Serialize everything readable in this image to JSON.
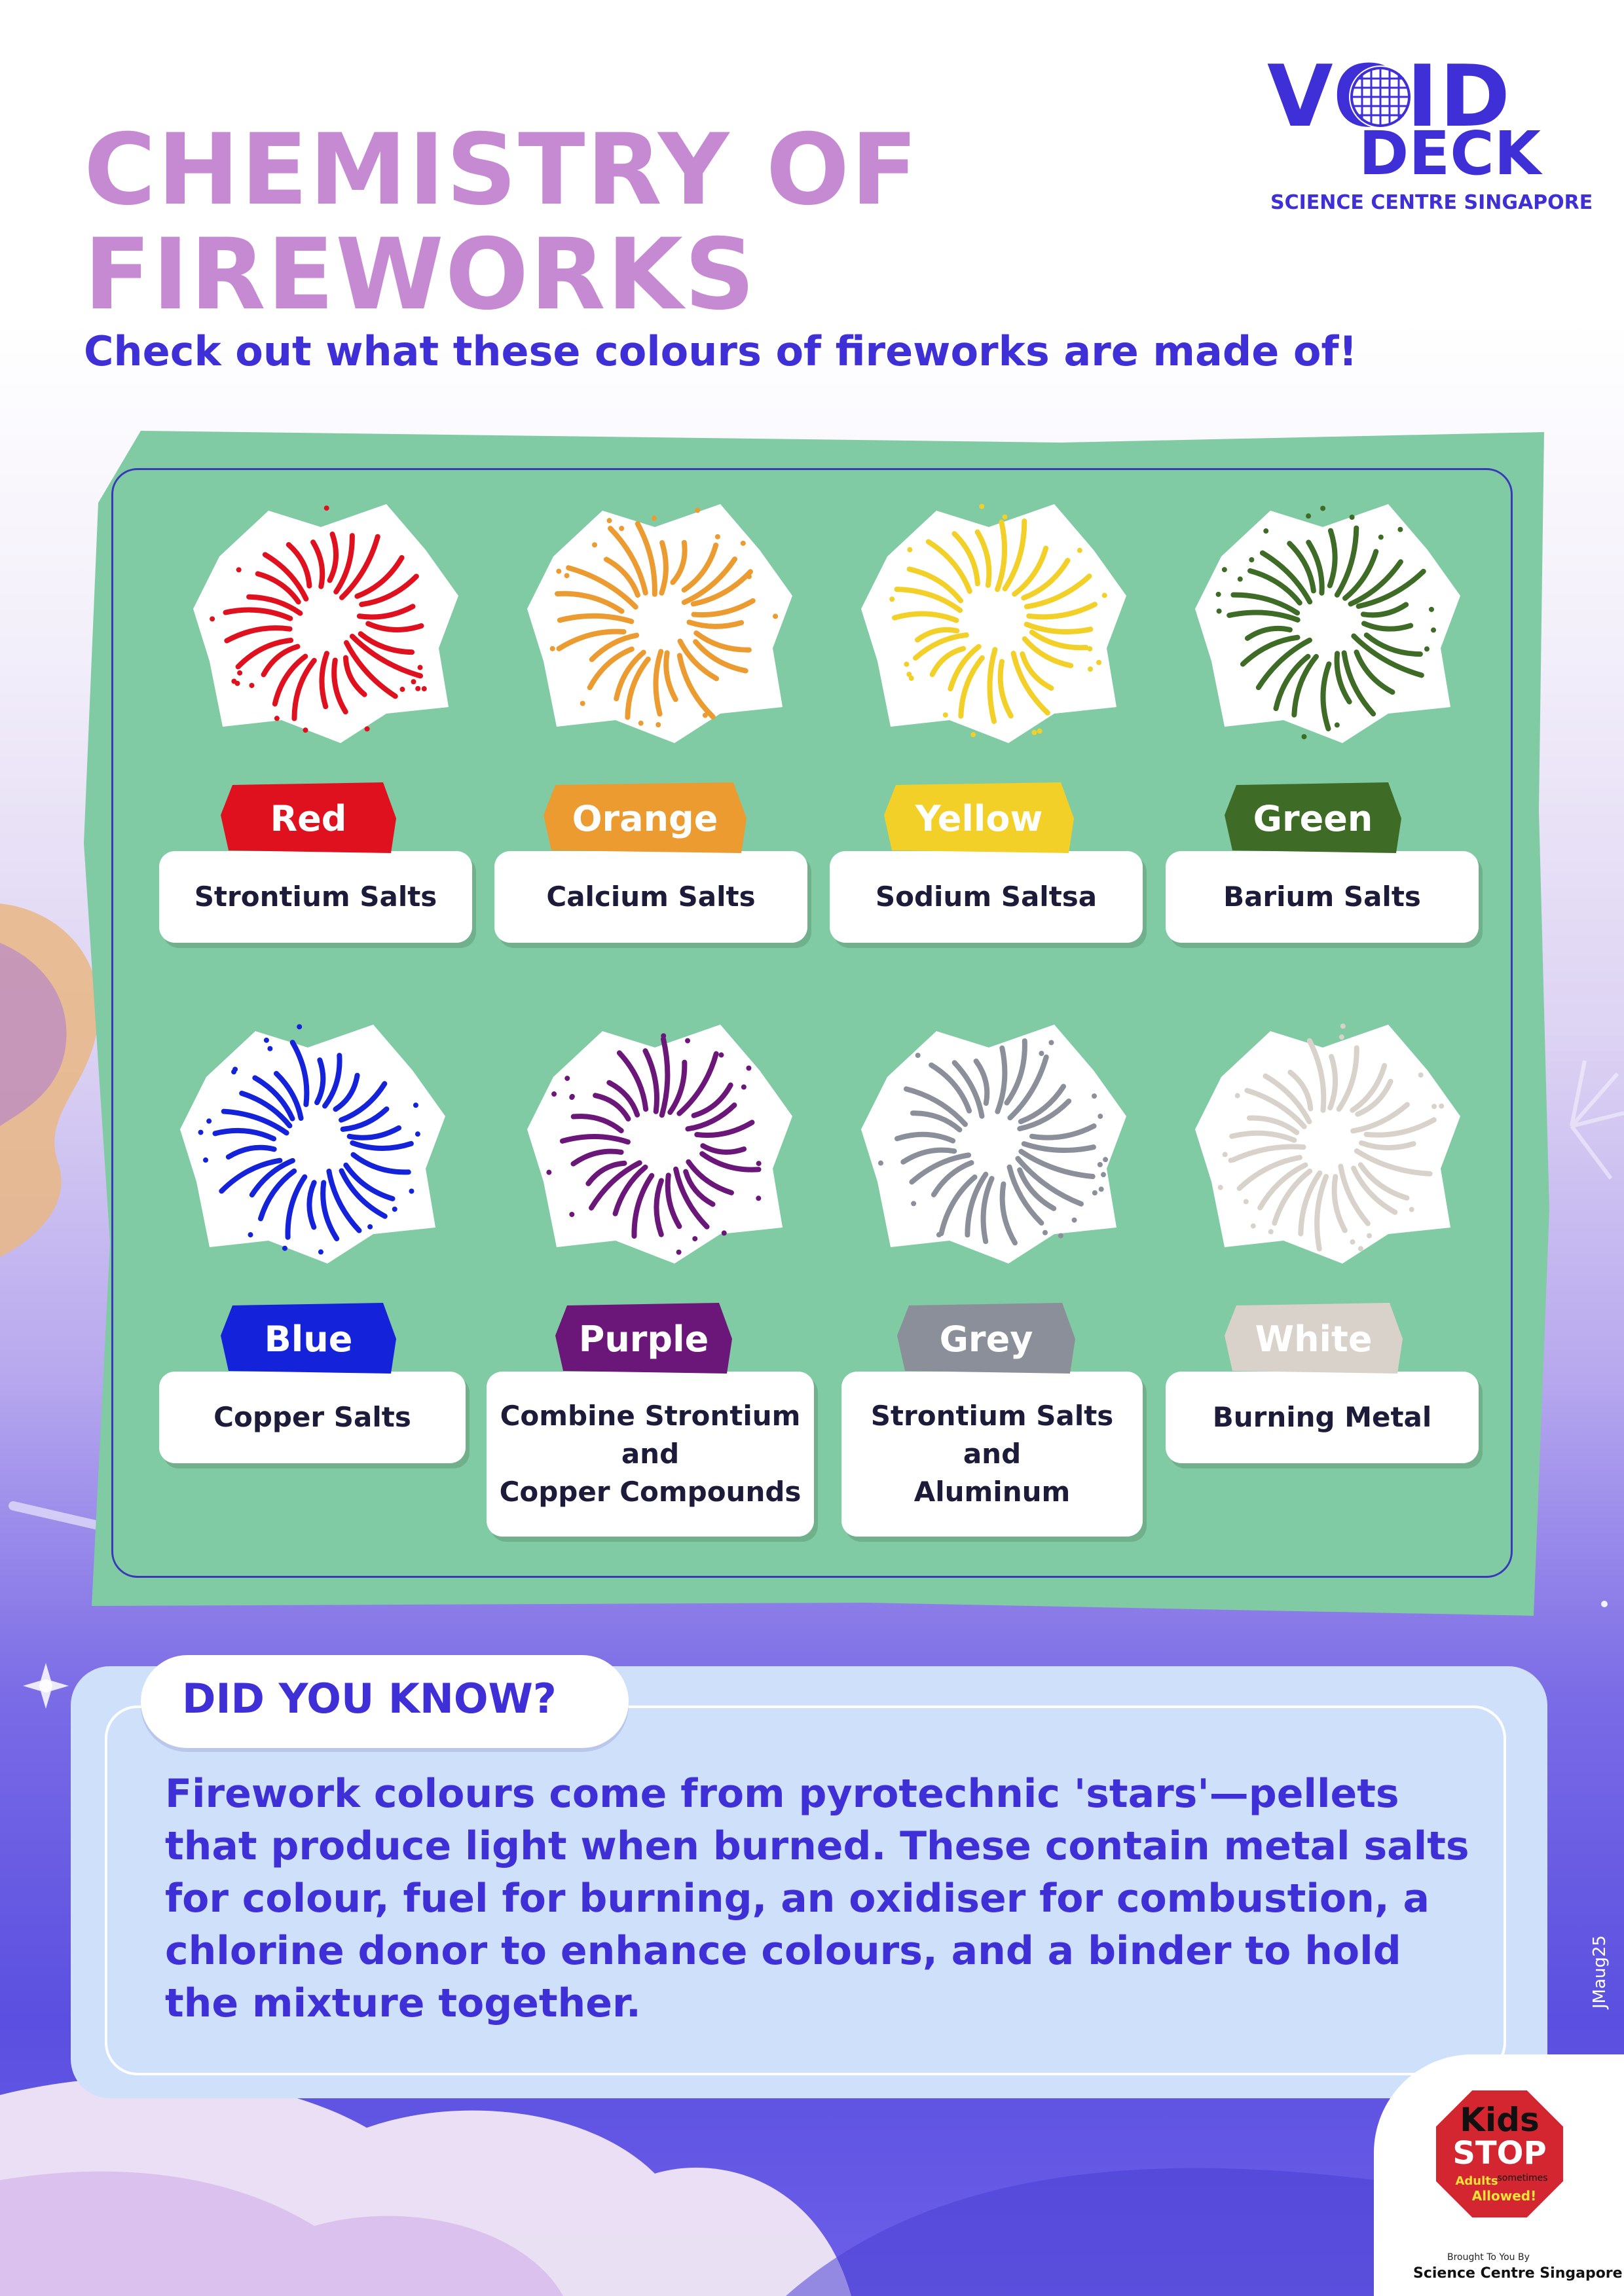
{
  "header": {
    "title_line1": "CHEMISTRY OF",
    "title_line2": "FIREWORKS",
    "subtitle": "Check out what these colours of fireworks are made of!"
  },
  "logo": {
    "line1": "VOID",
    "line2": "DECK",
    "sub": "SCIENCE CENTRE SINGAPORE"
  },
  "fireworks": [
    {
      "label": "Red",
      "compound": "Strontium Salts",
      "color": "#e0111f",
      "label_color": "#ffffff"
    },
    {
      "label": "Orange",
      "compound": "Calcium Salts",
      "color": "#eb9b30",
      "label_color": "#ffffff"
    },
    {
      "label": "Yellow",
      "compound": "Sodium Saltsa",
      "color": "#f2d028",
      "label_color": "#ffffff"
    },
    {
      "label": "Green",
      "compound": "Barium Salts",
      "color": "#3e6b25",
      "label_color": "#ffffff"
    },
    {
      "label": "Blue",
      "compound": "Copper Salts",
      "color": "#1422d9",
      "label_color": "#ffffff"
    },
    {
      "label": "Purple",
      "compound": "Combine Strontium and Copper Compounds",
      "compound_lines": [
        "Combine Strontium",
        "and",
        "Copper Compounds"
      ],
      "color": "#6b1779",
      "label_color": "#ffffff"
    },
    {
      "label": "Grey",
      "compound": "Strontium Salts and Aluminum",
      "compound_lines": [
        "Strontium Salts",
        "and",
        "Aluminum"
      ],
      "color": "#8a8f99",
      "label_color": "#ffffff"
    },
    {
      "label": "White",
      "compound": "Burning Metal",
      "color": "#d8d2ca",
      "label_color": "#ffffff"
    }
  ],
  "did_you_know": {
    "title": "DID YOU KNOW?",
    "text": "Firework colours come from pyrotechnic 'stars'—pellets that produce light when burned. These contain metal salts for colour, fuel for burning, an oxidiser for combustion, a chlorine donor to enhance colours, and a binder to hold the mixture together."
  },
  "credit": "JMaug25",
  "badge": {
    "kids": "Kids",
    "stop": "STOP",
    "adults": "Adults",
    "sometimes": "sometimes",
    "allowed": "Allowed!",
    "brought_by": "Brought To You By",
    "brought_org": "Science Centre Singapore"
  },
  "colors": {
    "title": "#c58ad1",
    "brand": "#3f2fd6",
    "panel": "#80cba3",
    "dyk_box": "#cfe0fb"
  }
}
